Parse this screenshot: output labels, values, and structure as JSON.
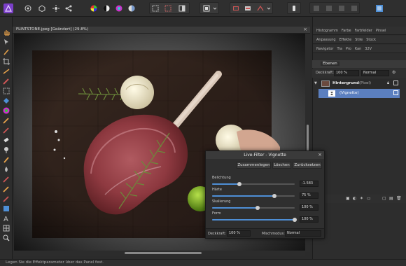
{
  "document": {
    "title": "FLINTSTONE.jpeg [Geändert] (29.8%)"
  },
  "panels": {
    "tabs_row1": [
      "Histogramm",
      "Farbe",
      "Farbfelder",
      "Pinsel"
    ],
    "tabs_row2": [
      "Anpassung",
      "Effekte",
      "Stile",
      "Stock"
    ],
    "tabs_row3": [
      "Navigator",
      "Tra",
      "Pro",
      "Kan",
      "32V"
    ],
    "layers_tab": "Ebenen",
    "opacity_label": "Deckkraft:",
    "opacity_value": "100 %",
    "blend_value": "Normal",
    "layer1_name": "Hintergrund",
    "layer1_kind": "(Pixel)",
    "layer2_name": "(Vignette)"
  },
  "dialog": {
    "title": "Live-Filter - Vignette",
    "btn_merge": "Zusammenlegen",
    "btn_delete": "Löschen",
    "btn_reset": "Zurücksetzen",
    "params": [
      {
        "label": "Belichtung",
        "value": "-1.583",
        "fraction": 0.33
      },
      {
        "label": "Härte",
        "value": "75 %",
        "fraction": 0.75
      },
      {
        "label": "Skalierung",
        "value": "100 %",
        "fraction": 0.55
      },
      {
        "label": "Form",
        "value": "100 %",
        "fraction": 1.0
      }
    ],
    "opacity_label": "Deckkraft:",
    "opacity_value": "100 %",
    "blend_label": "Mischmodus:",
    "blend_value": "Normal"
  },
  "status": {
    "text": "Legen Sie die Effektparameter über das Panel fest."
  },
  "colors": {
    "accent": "#4e8fd6",
    "app_bg": "#2b2b2b",
    "selected_layer": "#5b7fbf"
  }
}
